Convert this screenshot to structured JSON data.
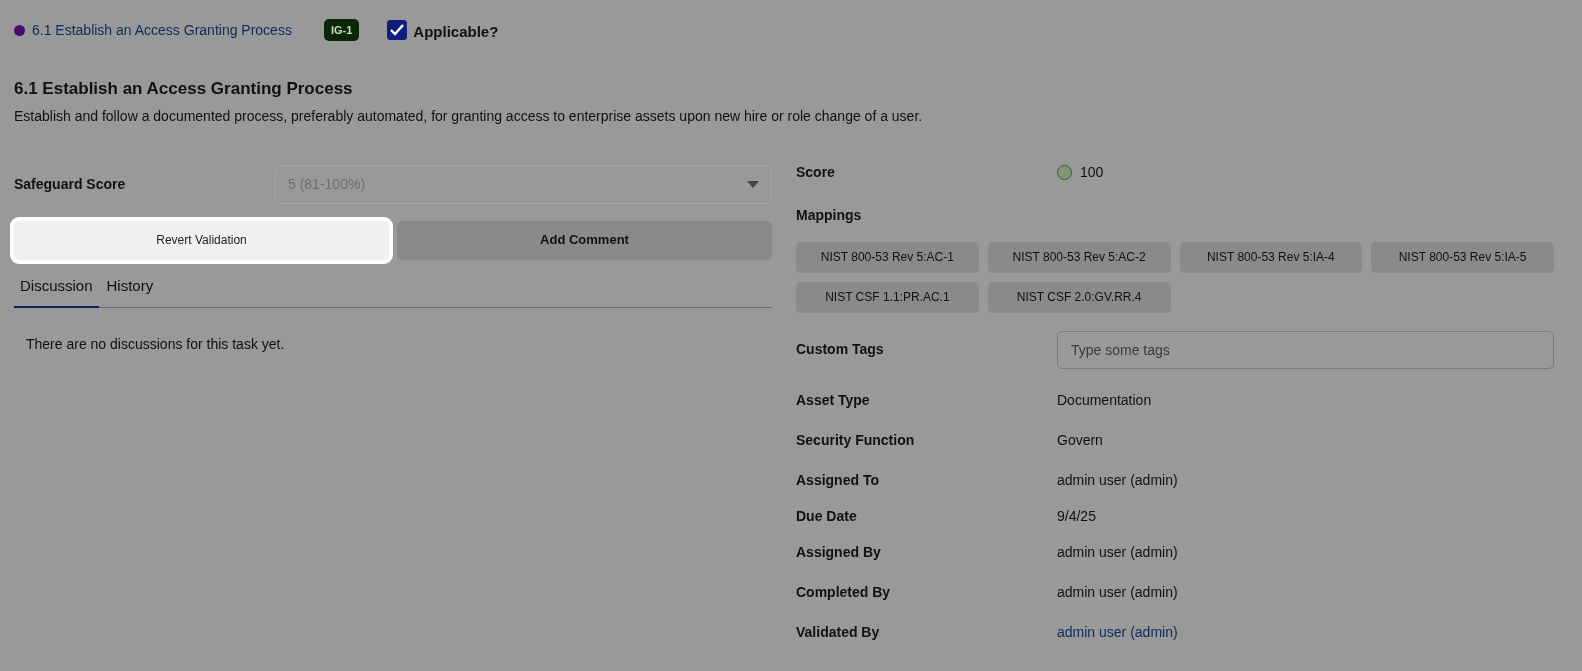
{
  "header": {
    "link": "6.1 Establish an Access Granting Process",
    "color": "#4b0a6e",
    "badge": "IG-1",
    "applicable": {
      "label": "Applicable?",
      "checked": true
    }
  },
  "safeguard": {
    "title": "6.1 Establish an Access Granting Process",
    "description": "Establish and follow a documented process, preferably automated, for granting access to enterprise assets upon new hire or role change of a user."
  },
  "score_select": {
    "label": "Safeguard Score",
    "value": "5 (81-100%)",
    "disabled": true
  },
  "buttons": [
    {
      "label": "Revert Validation",
      "focused": true
    },
    {
      "label": "Add Comment",
      "focused": false
    }
  ],
  "tabs": [
    {
      "label": "Discussion",
      "selected": true
    },
    {
      "label": "History",
      "selected": false
    }
  ],
  "discussion_empty": "There are no discussions for this task yet.",
  "score": {
    "label": "Score",
    "value": "100"
  },
  "mappings": {
    "label": "Mappings",
    "items": [
      "NIST 800-53 Rev 5:AC-1",
      "NIST 800-53 Rev 5:AC-2",
      "NIST 800-53 Rev 5:IA-4",
      "NIST 800-53 Rev 5:IA-5",
      "NIST CSF 1.1:PR.AC.1",
      "NIST CSF 2.0:GV.RR.4"
    ]
  },
  "custom_tags": {
    "label": "Custom Tags",
    "placeholder": "Type some tags"
  },
  "fields": [
    {
      "label": "Asset Type",
      "value": "Documentation",
      "kind": "text"
    },
    {
      "label": "Security Function",
      "value": "Govern",
      "kind": "text"
    },
    {
      "label": "Assigned To",
      "value": "admin user (admin)",
      "kind": "text"
    },
    {
      "label": "Due Date",
      "value": "9/4/25",
      "kind": "text"
    },
    {
      "label": "Assigned By",
      "value": "admin user (admin)",
      "kind": "text"
    },
    {
      "label": "Completed By",
      "value": "admin user (admin)",
      "kind": "text"
    },
    {
      "label": "Validated By",
      "value": "admin user (admin)",
      "kind": "link"
    }
  ]
}
